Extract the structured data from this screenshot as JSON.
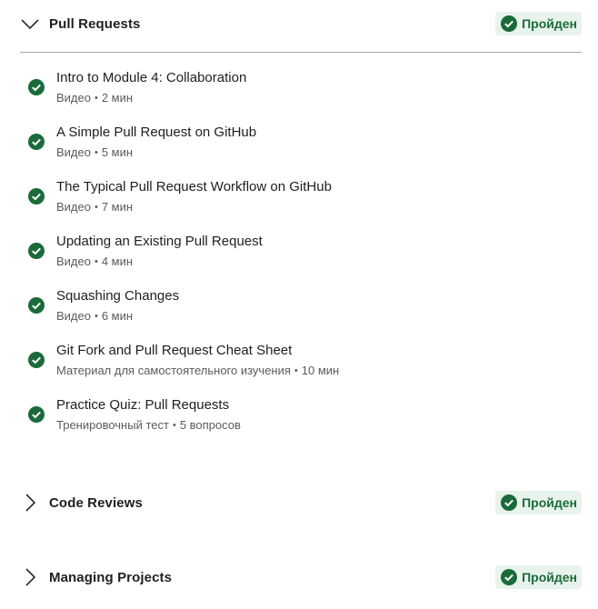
{
  "colors": {
    "success": "#1b6b3a",
    "badge_bg": "#e8f3ec",
    "text": "#1f1f1f",
    "muted": "#5b5b5b",
    "divider": "#a8a8a8"
  },
  "sections": [
    {
      "title": "Pull Requests",
      "status": "Пройден",
      "expanded": true,
      "chevron_icon": "chevron-down-icon",
      "items": [
        {
          "title": "Intro to Module 4: Collaboration",
          "type": "Видео",
          "detail": "2 мин",
          "icon": "check-circle-icon"
        },
        {
          "title": "A Simple Pull Request on GitHub",
          "type": "Видео",
          "detail": "5 мин",
          "icon": "check-circle-icon"
        },
        {
          "title": "The Typical Pull Request Workflow on GitHub",
          "type": "Видео",
          "detail": "7 мин",
          "icon": "check-circle-icon"
        },
        {
          "title": "Updating an Existing Pull Request",
          "type": "Видео",
          "detail": "4 мин",
          "icon": "check-circle-icon"
        },
        {
          "title": "Squashing Changes",
          "type": "Видео",
          "detail": "6 мин",
          "icon": "check-circle-icon"
        },
        {
          "title": "Git Fork and Pull Request Cheat Sheet",
          "type": "Материал для самостоятельного изучения",
          "detail": "10 мин",
          "icon": "check-circle-icon"
        },
        {
          "title": "Practice Quiz: Pull Requests",
          "type": "Тренировочный тест",
          "detail": "5 вопросов",
          "icon": "check-circle-icon"
        }
      ]
    },
    {
      "title": "Code Reviews",
      "status": "Пройден",
      "expanded": false,
      "chevron_icon": "chevron-right-icon"
    },
    {
      "title": "Managing Projects",
      "status": "Пройден",
      "expanded": false,
      "chevron_icon": "chevron-right-icon"
    }
  ],
  "separator": "•"
}
